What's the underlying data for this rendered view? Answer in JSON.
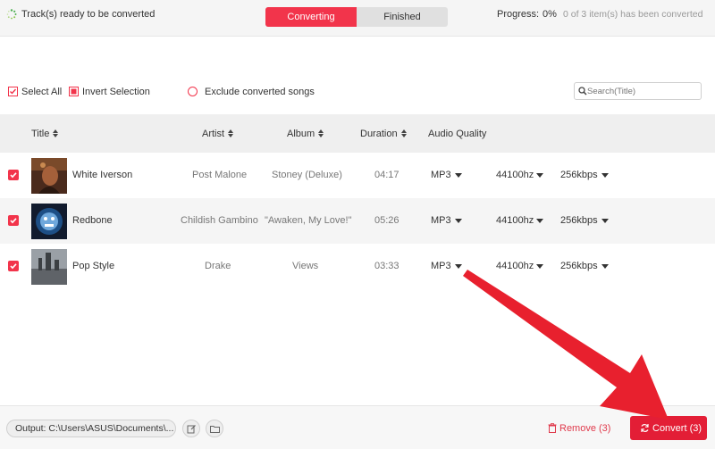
{
  "tabs": [
    {
      "label": "Converting",
      "active": true
    },
    {
      "label": "Finished",
      "active": false
    }
  ],
  "status": {
    "message": "Track(s) ready to be converted",
    "progress_label": "Progress:",
    "progress_value": "0%",
    "progress_count": "0 of 3 item(s) has been converted"
  },
  "toolbar": {
    "select_all": "Select All",
    "invert_selection": "Invert Selection",
    "exclude_converted": "Exclude converted songs"
  },
  "search": {
    "placeholder": "Search(Title)",
    "value": ""
  },
  "columns": {
    "title": "Title",
    "artist": "Artist",
    "album": "Album",
    "duration": "Duration",
    "audio_quality": "Audio Quality"
  },
  "rows": [
    {
      "title": "White Iverson",
      "artist": "Post Malone",
      "album": "Stoney (Deluxe)",
      "duration": "04:17",
      "format": "MP3",
      "sample_rate": "44100hz",
      "bitrate": "256kbps",
      "checked": true
    },
    {
      "title": "Redbone",
      "artist": "Childish Gambino",
      "album": "\"Awaken, My Love!\"",
      "duration": "05:26",
      "format": "MP3",
      "sample_rate": "44100hz",
      "bitrate": "256kbps",
      "checked": true
    },
    {
      "title": "Pop Style",
      "artist": "Drake",
      "album": "Views",
      "duration": "03:33",
      "format": "MP3",
      "sample_rate": "44100hz",
      "bitrate": "256kbps",
      "checked": true
    }
  ],
  "footer": {
    "output_path": "Output: C:\\Users\\ASUS\\Documents\\...",
    "remove_label": "Remove (3)",
    "convert_label": "Convert (3)"
  },
  "colors": {
    "accent": "#f2344b",
    "convert": "#e31e36",
    "arrow": "#e8202e"
  }
}
